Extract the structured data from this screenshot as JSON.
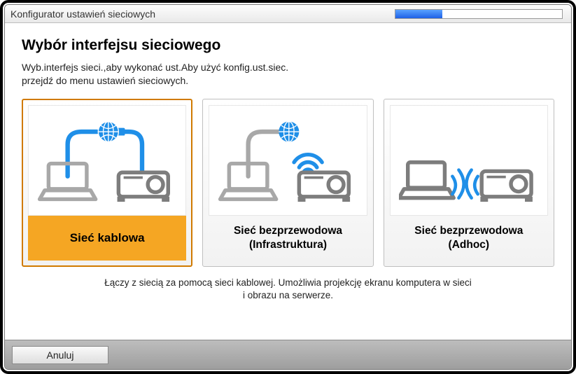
{
  "window": {
    "title": "Konfigurator ustawień sieciowych",
    "progress_pct": 28
  },
  "page": {
    "heading": "Wybór interfejsu sieciowego",
    "instructions": "Wyb.interfejs sieci.,aby wykonać ust.Aby użyć konfig.ust.siec.\nprzejdź do menu ustawień sieciowych."
  },
  "options": {
    "wired": {
      "label": "Sieć kablowa",
      "selected": true
    },
    "infra": {
      "label": "Sieć bezprzewodowa\n(Infrastruktura)",
      "selected": false
    },
    "adhoc": {
      "label": "Sieć bezprzewodowa\n(Adhoc)",
      "selected": false
    }
  },
  "description": "Łączy z siecią za pomocą sieci kablowej. Umożliwia projekcję ekranu komputera w sieci\ni obrazu na serwerze.",
  "footer": {
    "cancel_label": "Anuluj"
  },
  "colors": {
    "accent_selected": "#f5a623",
    "wire_blue": "#1f8fe8",
    "icon_gray": "#7d7d7d"
  }
}
